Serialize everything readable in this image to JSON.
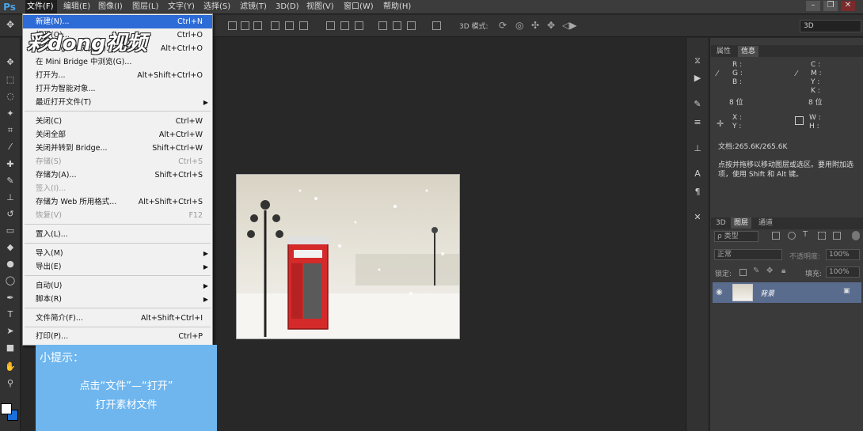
{
  "app": {
    "logo": "Ps"
  },
  "menubar": {
    "items": [
      "文件(F)",
      "编辑(E)",
      "图像(I)",
      "图层(L)",
      "文字(Y)",
      "选择(S)",
      "滤镜(T)",
      "3D(D)",
      "视图(V)",
      "窗口(W)",
      "帮助(H)"
    ],
    "window_buttons": [
      "–",
      "❐",
      "✕"
    ]
  },
  "options_bar": {
    "mode3d_label": "3D 模式:",
    "workspace_select": "3D"
  },
  "file_menu": {
    "items": [
      {
        "label": "新建(N)...",
        "shortcut": "Ctrl+N"
      },
      {
        "label": "打开(O)...",
        "shortcut": "Ctrl+O"
      },
      {
        "label": "在 Bridge 中浏览(B)...",
        "shortcut": "Alt+Ctrl+O"
      },
      {
        "label": "在 Mini Bridge 中浏览(G)...",
        "shortcut": ""
      },
      {
        "label": "打开为...",
        "shortcut": "Alt+Shift+Ctrl+O"
      },
      {
        "label": "打开为智能对象...",
        "shortcut": ""
      },
      {
        "label": "最近打开文件(T)",
        "shortcut": ""
      },
      {
        "label": "关闭(C)",
        "shortcut": "Ctrl+W"
      },
      {
        "label": "关闭全部",
        "shortcut": "Alt+Ctrl+W"
      },
      {
        "label": "关闭并转到 Bridge...",
        "shortcut": "Shift+Ctrl+W"
      },
      {
        "label": "存储(S)",
        "shortcut": "Ctrl+S"
      },
      {
        "label": "存储为(A)...",
        "shortcut": "Shift+Ctrl+S"
      },
      {
        "label": "签入(I)...",
        "shortcut": ""
      },
      {
        "label": "存储为 Web 所用格式...",
        "shortcut": "Alt+Shift+Ctrl+S"
      },
      {
        "label": "恢复(V)",
        "shortcut": "F12"
      },
      {
        "label": "置入(L)...",
        "shortcut": ""
      },
      {
        "label": "导入(M)",
        "shortcut": ""
      },
      {
        "label": "导出(E)",
        "shortcut": ""
      },
      {
        "label": "自动(U)",
        "shortcut": ""
      },
      {
        "label": "脚本(R)",
        "shortcut": ""
      },
      {
        "label": "文件简介(F)...",
        "shortcut": "Alt+Shift+Ctrl+I"
      },
      {
        "label": "打印(P)...",
        "shortcut": "Ctrl+P"
      }
    ]
  },
  "watermark": "彩dong视频",
  "tip": {
    "title": "小提示：",
    "line1": "点击“文件”—“打开”",
    "line2": "打开素材文件"
  },
  "panels": {
    "top_tabs": [
      "属性",
      "信息"
    ],
    "info": {
      "r": "R :",
      "g": "G :",
      "b": "B :",
      "c": "C :",
      "m": "M :",
      "y": "Y :",
      "k": "K :",
      "bits_left": "8 位",
      "bits_right": "8 位",
      "x": "X :",
      "ycoord": "Y :",
      "w": "W :",
      "h": "H :",
      "doc": "文档:265.6K/265.6K",
      "desc": "点按并拖移以移动图层或选区。要用附加选项，使用 Shift 和 Alt 键。"
    },
    "layer_tabs": [
      "3D",
      "图层",
      "通道"
    ],
    "layers": {
      "filter_kind": "ρ 类型",
      "blend_mode": "正常",
      "opacity_label": "不透明度:",
      "opacity_value": "100%",
      "lock_label": "锁定:",
      "fill_label": "填充:",
      "fill_value": "100%",
      "layer_name": "背景"
    }
  }
}
